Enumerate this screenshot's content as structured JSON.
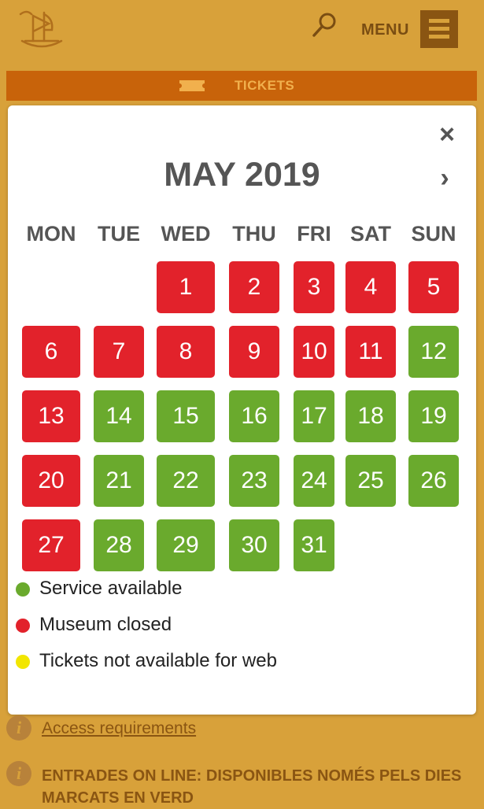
{
  "header": {
    "menu_label": "MENU",
    "logo_icon": "ship-logo",
    "search_icon": "search-icon"
  },
  "tickets_bar": {
    "label": "TICKETS"
  },
  "calendar": {
    "title": "MAY 2019",
    "close_glyph": "×",
    "next_glyph": "›",
    "weekdays": [
      "MON",
      "TUE",
      "WED",
      "THU",
      "FRI",
      "SAT",
      "SUN"
    ],
    "days": [
      {
        "day": "1",
        "status": "closed"
      },
      {
        "day": "2",
        "status": "closed"
      },
      {
        "day": "3",
        "status": "closed"
      },
      {
        "day": "4",
        "status": "closed"
      },
      {
        "day": "5",
        "status": "closed"
      },
      {
        "day": "6",
        "status": "closed"
      },
      {
        "day": "7",
        "status": "closed"
      },
      {
        "day": "8",
        "status": "closed"
      },
      {
        "day": "9",
        "status": "closed"
      },
      {
        "day": "10",
        "status": "closed"
      },
      {
        "day": "11",
        "status": "closed"
      },
      {
        "day": "12",
        "status": "available"
      },
      {
        "day": "13",
        "status": "closed"
      },
      {
        "day": "14",
        "status": "available"
      },
      {
        "day": "15",
        "status": "available"
      },
      {
        "day": "16",
        "status": "available"
      },
      {
        "day": "17",
        "status": "available"
      },
      {
        "day": "18",
        "status": "available"
      },
      {
        "day": "19",
        "status": "available"
      },
      {
        "day": "20",
        "status": "closed"
      },
      {
        "day": "21",
        "status": "available"
      },
      {
        "day": "22",
        "status": "available"
      },
      {
        "day": "23",
        "status": "available"
      },
      {
        "day": "24",
        "status": "available"
      },
      {
        "day": "25",
        "status": "available"
      },
      {
        "day": "26",
        "status": "available"
      },
      {
        "day": "27",
        "status": "closed"
      },
      {
        "day": "28",
        "status": "available"
      },
      {
        "day": "29",
        "status": "available"
      },
      {
        "day": "30",
        "status": "available"
      },
      {
        "day": "31",
        "status": "available"
      }
    ]
  },
  "legend": [
    {
      "label": "Service available",
      "color": "#6aaa2d"
    },
    {
      "label": "Museum closed",
      "color": "#e2222b"
    },
    {
      "label": "Tickets not available for web",
      "color": "#f2e600"
    }
  ],
  "info": {
    "icon_glyph": "i",
    "access_link": "Access requirements",
    "entrades_text": "ENTRADES ON LINE: DISPONIBLES NOMÉS PELS DIES MARCATS EN VERD"
  }
}
